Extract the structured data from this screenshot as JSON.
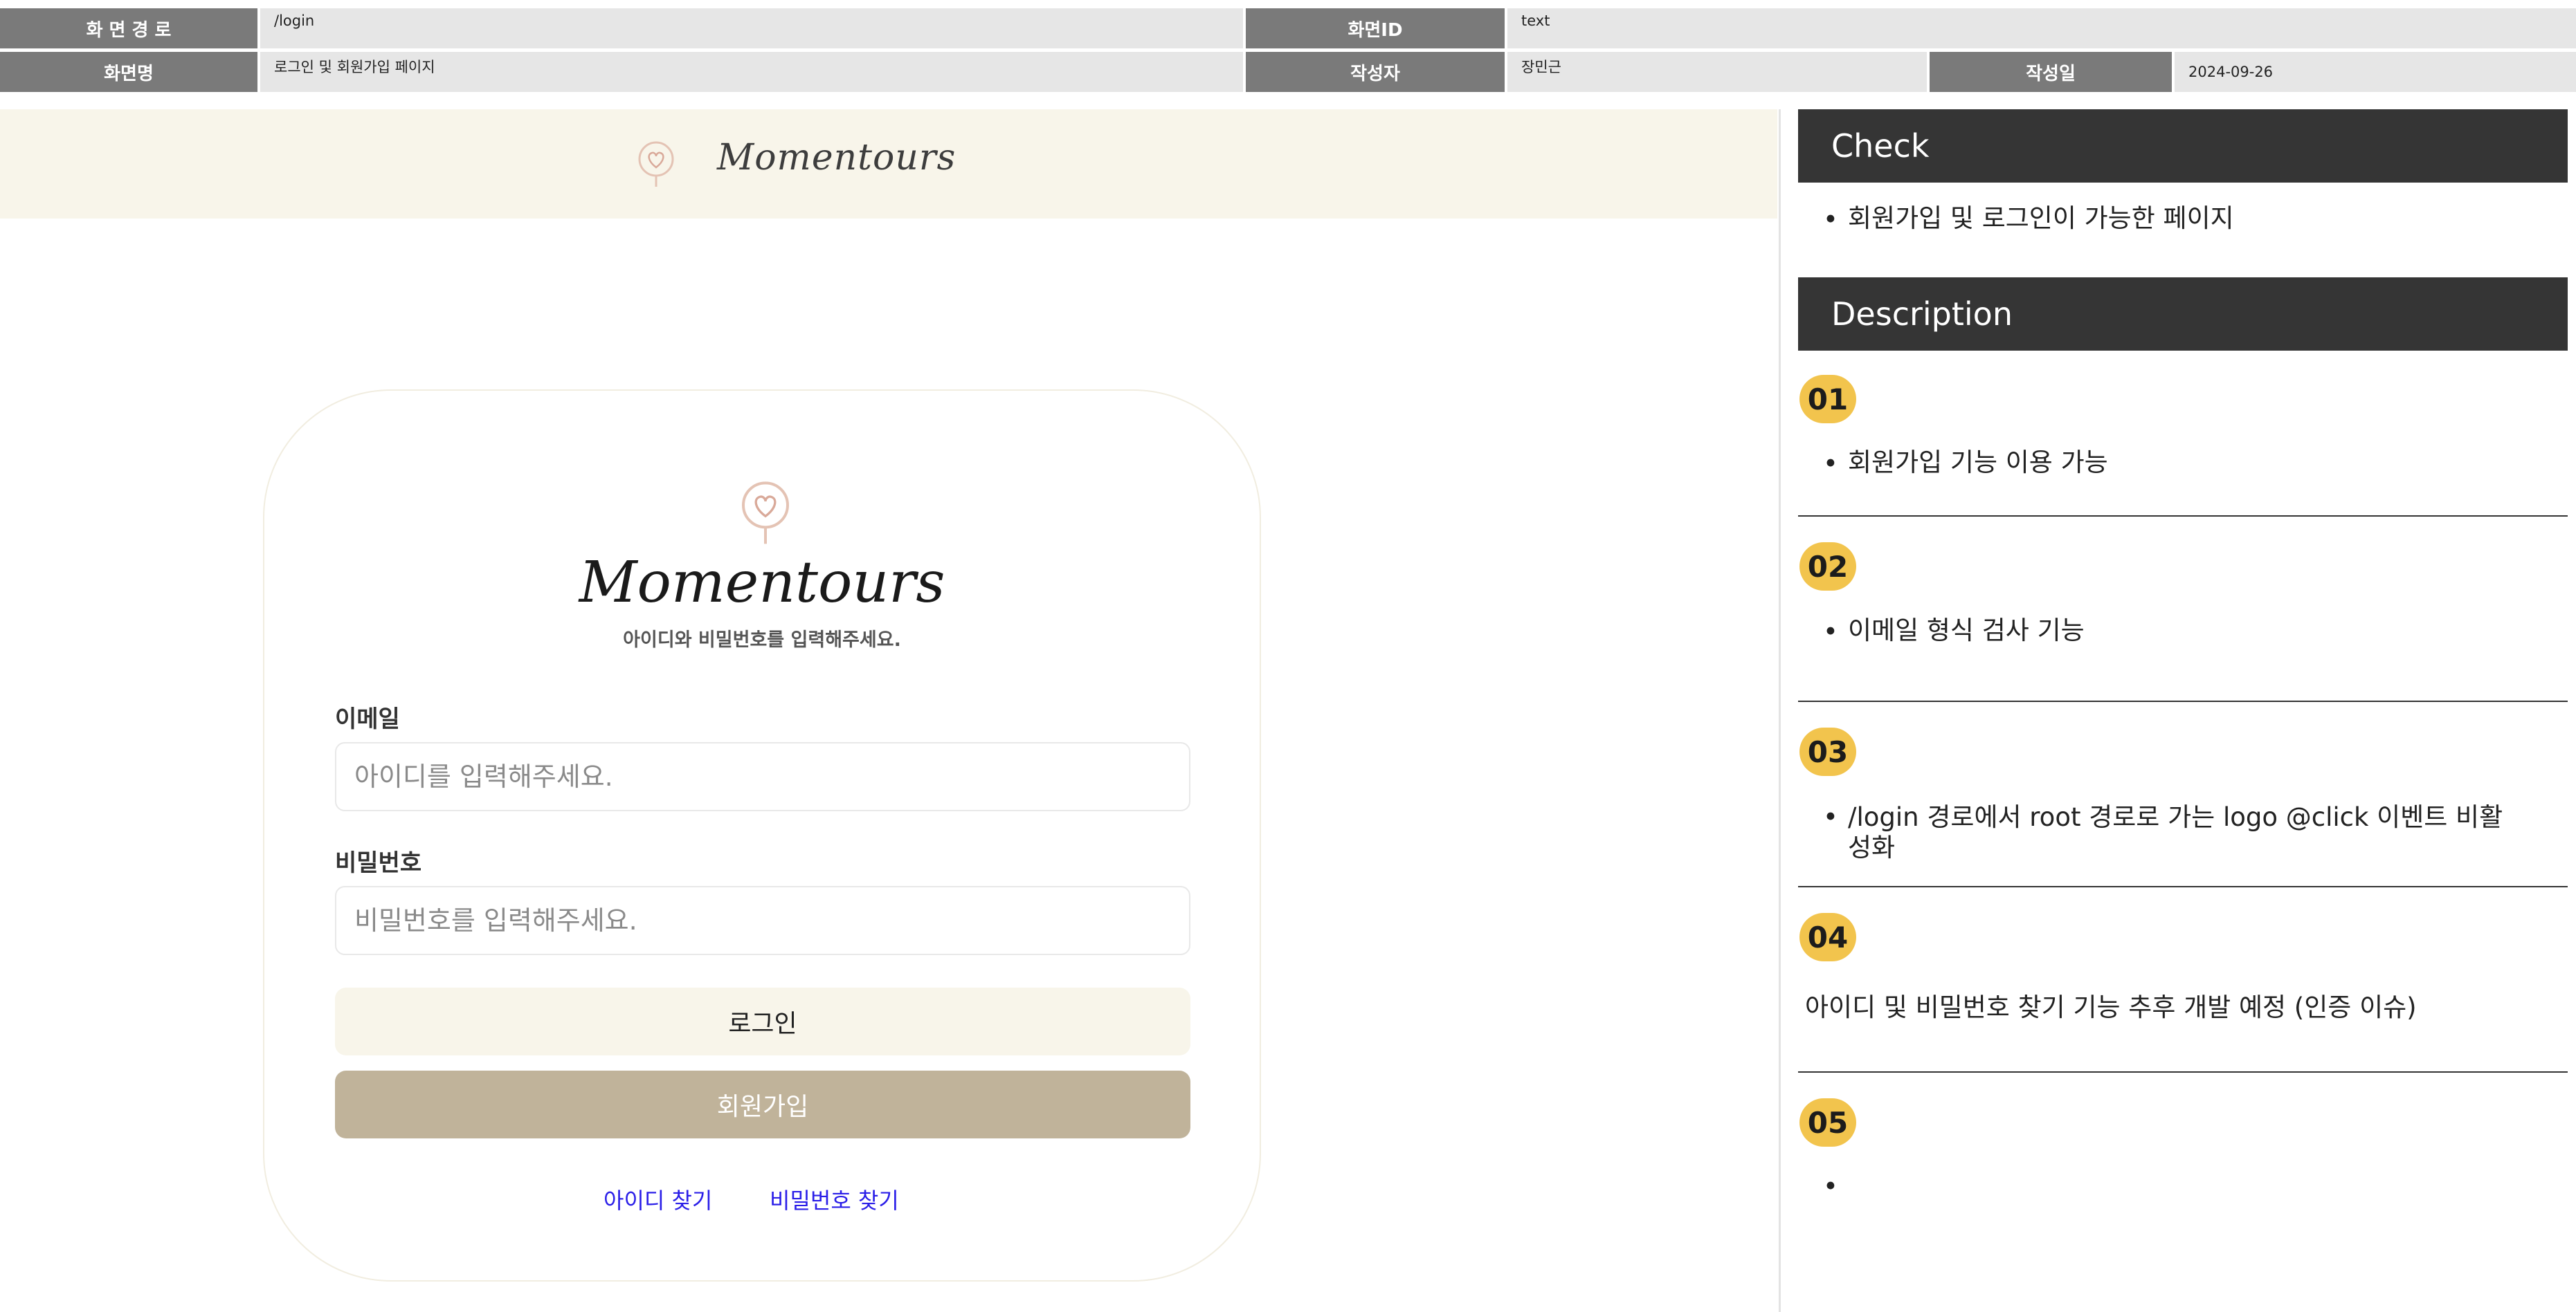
{
  "meta": {
    "path_label": "화 면 경 로",
    "path_value": "/login",
    "screen_id_label": "화면ID",
    "screen_id_value": "text",
    "screen_name_label": "화면명",
    "screen_name_value": "로그인 및 회원가입 페이지",
    "author_label": "작성자",
    "author_value": "장민근",
    "date_label": "작성일",
    "date_value": "2024-09-26"
  },
  "app": {
    "brand": "Momentours",
    "card_brand": "Momentours",
    "subtitle": "아이디와 비밀번호를 입력해주세요.",
    "email_label": "이메일",
    "email_placeholder": "아이디를 입력해주세요.",
    "password_label": "비밀번호",
    "password_placeholder": "비밀번호를 입력해주세요.",
    "login_button": "로그인",
    "signup_button": "회원가입",
    "find_id_link": "아이디 찾기",
    "find_pw_link": "비밀번호 찾기"
  },
  "panel": {
    "check_title": "Check",
    "check_items": [
      "회원가입 및 로그인이 가능한 페이지"
    ],
    "description_title": "Description",
    "descriptions": [
      {
        "num": "01",
        "bullet": "•",
        "text": "회원가입 기능 이용 가능"
      },
      {
        "num": "02",
        "bullet": "•",
        "text": "이메일 형식 검사 기능"
      },
      {
        "num": "03",
        "bullet": "•",
        "text_line1": "/login 경로에서 root 경로로 가는 logo @click 이벤트 비활",
        "text_line2": "성화"
      },
      {
        "num": "04",
        "text": "아이디 및 비밀번호 찾기 기능 추후 개발 예정 (인증 이슈)"
      },
      {
        "num": "05",
        "bullet": "•",
        "text": ""
      }
    ]
  },
  "colors": {
    "label_bg": "#7a7a7a",
    "value_bg": "#e6e6e6",
    "brand_bg": "#f8f5ea",
    "signup_bg": "#c0b39a",
    "section_header_bg": "#353535",
    "badge_bg": "#f2c44d",
    "link": "#2a1ee8"
  },
  "icons": {
    "logo": "heart-balloon-icon"
  }
}
